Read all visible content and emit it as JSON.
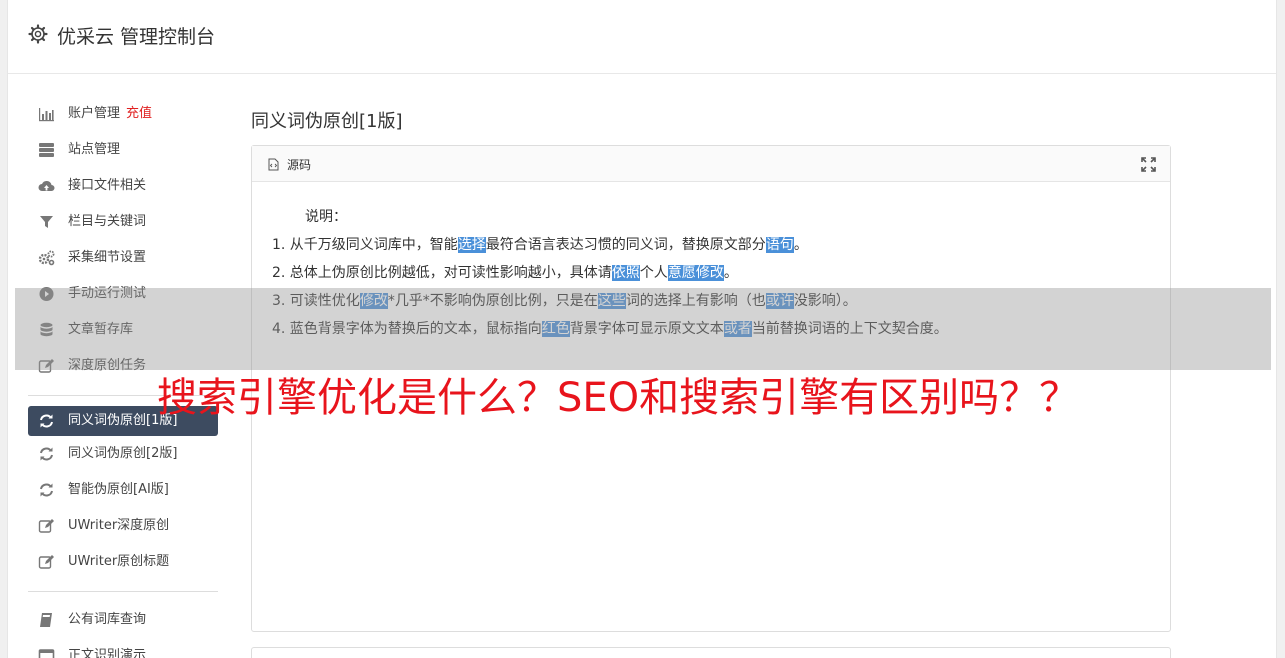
{
  "header": {
    "title": "优采云 管理控制台",
    "icon": "gear-icon"
  },
  "sidebar": {
    "items": [
      {
        "label": "账户管理",
        "badge": "充值",
        "icon": "bar-chart-icon"
      },
      {
        "label": "站点管理",
        "icon": "server-icon"
      },
      {
        "label": "接口文件相关",
        "icon": "cloud-upload-icon"
      },
      {
        "label": "栏目与关键词",
        "icon": "filter-icon"
      },
      {
        "label": "采集细节设置",
        "icon": "gears-icon"
      },
      {
        "label": "手动运行测试",
        "icon": "play-circle-icon"
      },
      {
        "label": "文章暂存库",
        "icon": "database-icon"
      },
      {
        "label": "深度原创任务",
        "icon": "edit-icon"
      }
    ],
    "items2": [
      {
        "label": "同义词伪原创[1版]",
        "icon": "refresh-icon",
        "active": true
      },
      {
        "label": "同义词伪原创[2版]",
        "icon": "refresh-icon"
      },
      {
        "label": "智能伪原创[AI版]",
        "icon": "refresh-icon"
      },
      {
        "label": "UWriter深度原创",
        "icon": "edit-icon"
      },
      {
        "label": "UWriter原创标题",
        "icon": "edit-icon"
      }
    ],
    "items3": [
      {
        "label": "公有词库查询",
        "icon": "book-icon"
      },
      {
        "label": "正文识别演示",
        "icon": "window-icon"
      }
    ]
  },
  "main": {
    "title": "同义词伪原创[1版]",
    "panel_label": "源码",
    "intro": "说明：",
    "lines": [
      [
        "1. 从千万级同义词库中，智能",
        {
          "hl": "选择"
        },
        "最符合语言表达习惯的同义词，替换原文部分",
        {
          "hl": "语句"
        },
        "。"
      ],
      [
        "2. 总体上伪原创比例越低，对可读性影响越小，具体请",
        {
          "hl": "依照"
        },
        "个人",
        {
          "hl": "意愿"
        },
        {
          "hl": "修改"
        },
        "。"
      ],
      [
        "3. 可读性优化",
        {
          "hl": "修改"
        },
        "*几乎*不影响伪原创比例，只是在",
        {
          "hl": "这些"
        },
        "词的选择上有影响（也",
        {
          "hl": "或许"
        },
        "没影响）。"
      ],
      [
        "4. 蓝色背景字体为替换后的文本，鼠标指向",
        {
          "hl": "红色"
        },
        "背景字体可显示原文文本",
        {
          "hl": "或者"
        },
        "当前替换词语的上下文契合度。"
      ]
    ]
  },
  "overlay": {
    "headline": "搜索引擎优化是什么？SEO和搜索引擎有区别吗？？"
  },
  "colors": {
    "active_bg": "#3d4b60",
    "highlight": "#4a90d9",
    "headline": "#e8141c",
    "recharge": "#e02020"
  }
}
